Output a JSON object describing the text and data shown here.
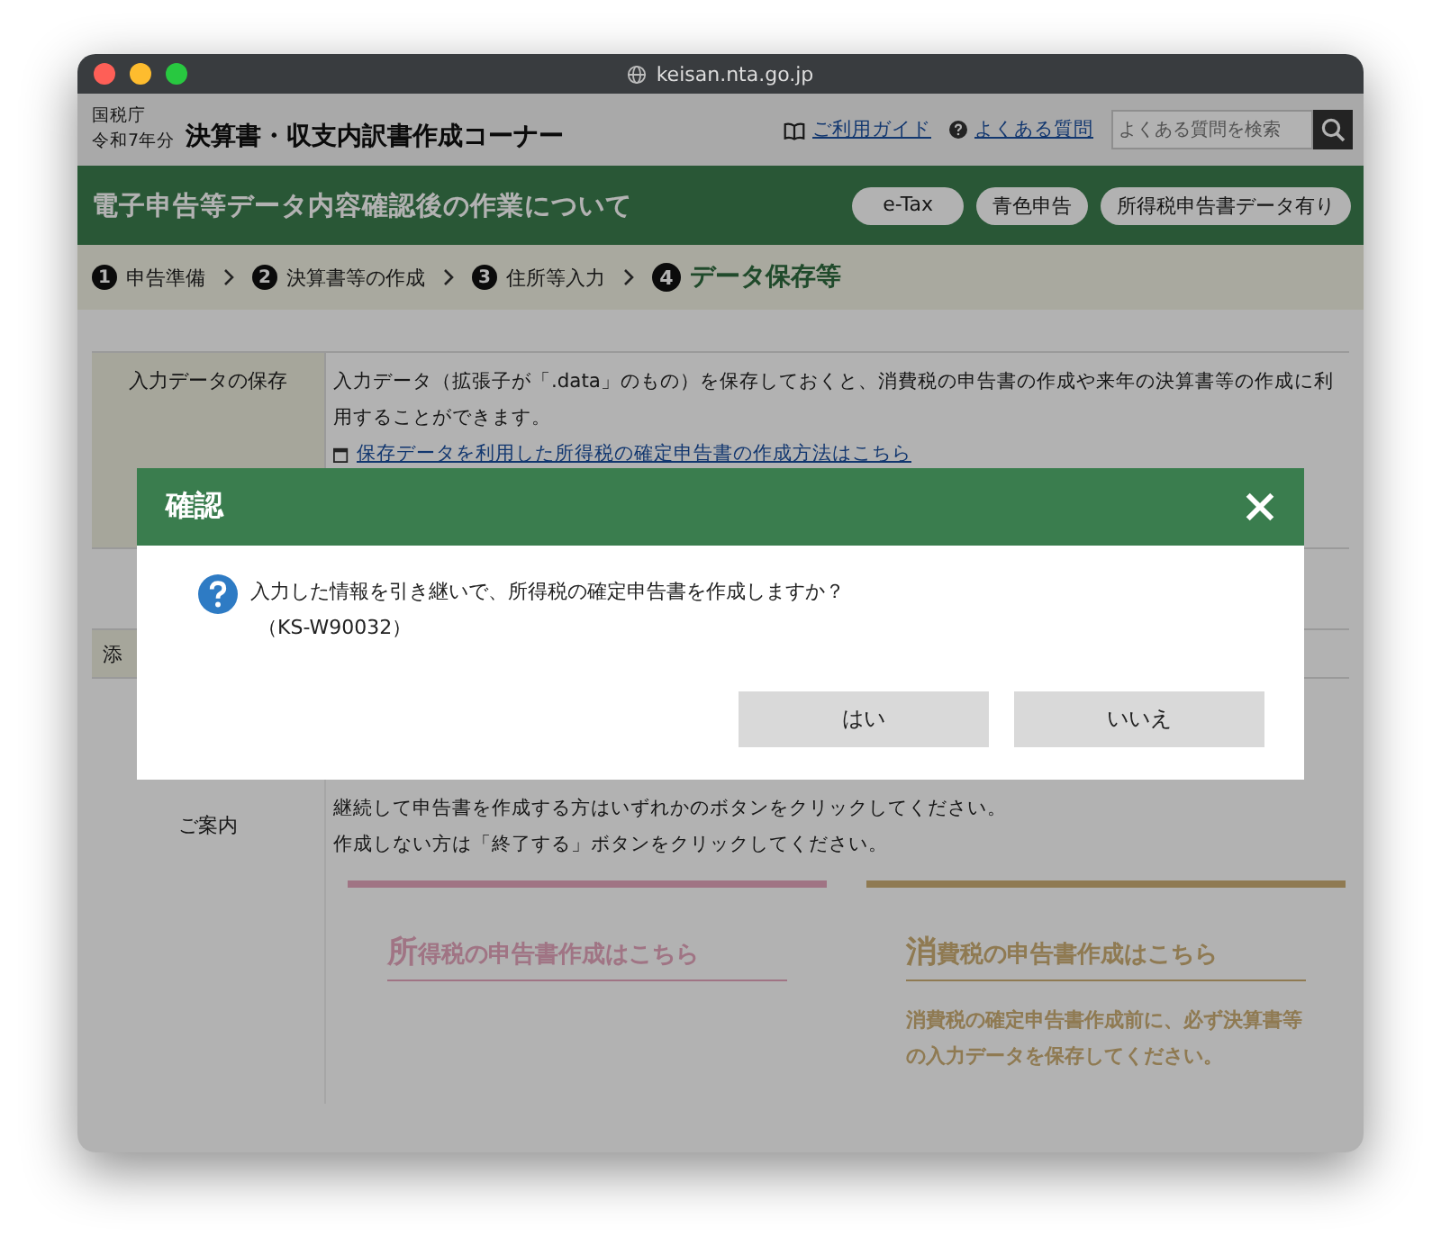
{
  "browser": {
    "url": "keisan.nta.go.jp"
  },
  "header": {
    "agency": "国税庁",
    "year": "令和7年分",
    "title": "決算書・収支内訳書作成コーナー",
    "links": [
      {
        "kind": "guide",
        "label": "ご利用ガイド"
      },
      {
        "kind": "faq",
        "label": "よくある質問"
      }
    ],
    "search": {
      "placeholder": "よくある質問を検索"
    }
  },
  "banner": {
    "title": "電子申告等データ内容確認後の作業について",
    "badges": [
      "e-Tax",
      "青色申告",
      "所得税申告書データ有り"
    ]
  },
  "steps": [
    {
      "number": "1",
      "label": "申告準備",
      "selected": false
    },
    {
      "number": "2",
      "label": "決算書等の作成",
      "selected": false
    },
    {
      "number": "3",
      "label": "住所等入力",
      "selected": false
    },
    {
      "number": "4",
      "label": "データ保存等",
      "selected": true
    }
  ],
  "table": {
    "rows": [
      {
        "label": "入力データの保存",
        "text": "入力データ（拡張子が「.data」のもの）を保存しておくと、消費税の申告書の作成や来年の決算書等の作成に利用することができます。",
        "link": "保存データを利用した所得税の確定申告書の作成方法はこちら"
      },
      {
        "label": "添"
      },
      {
        "label": "ご案内",
        "lines": [
          "継続して申告書を作成する方はいずれかのボタンをクリックしてください。",
          "作成しない方は「終了する」ボタンをクリックしてください。"
        ],
        "cards": [
          {
            "title": "所得税の申告書作成はこちら",
            "color": "#a07484"
          },
          {
            "title": "消費税の申告書作成はこちら",
            "color": "#8f7a52",
            "note": "消費税の確定申告書作成前に、必ず決算書等の入力データを保存してください。"
          }
        ]
      }
    ]
  },
  "dialog": {
    "title": "確認",
    "message": "入力した情報を引き継いで、所得税の確定申告書を作成しますか？",
    "code": "（KS-W90032）",
    "buttons": [
      "はい",
      "いいえ"
    ]
  }
}
